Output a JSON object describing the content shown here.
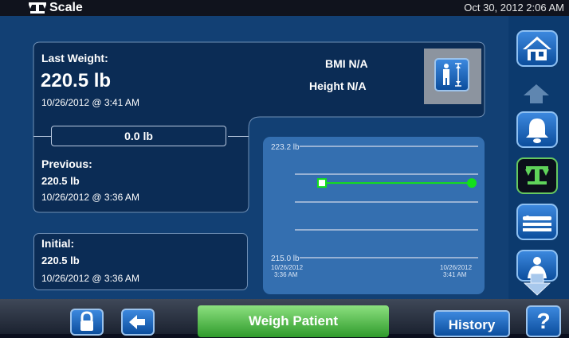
{
  "header": {
    "title": "Scale",
    "datetime": "Oct 30, 2012 2:06 AM"
  },
  "last_weight": {
    "label": "Last Weight:",
    "value": "220.5 lb",
    "timestamp": "10/26/2012 @ 3:41 AM"
  },
  "bmi": "BMI N/A",
  "height": "Height N/A",
  "difference": "0.0 lb",
  "previous": {
    "label": "Previous:",
    "value": "220.5 lb",
    "timestamp": "10/26/2012 @ 3:36 AM"
  },
  "initial": {
    "label": "Initial:",
    "value": "220.5 lb",
    "timestamp": "10/26/2012 @ 3:36 AM"
  },
  "chart_data": {
    "type": "line",
    "ylim": [
      215.0,
      223.2
    ],
    "y_tick_labels": [
      "223.2 lb",
      "215.0 lb"
    ],
    "x_labels": [
      {
        "date": "10/26/2012",
        "time": "3:36 AM"
      },
      {
        "date": "10/26/2012",
        "time": "3:41 AM"
      }
    ],
    "series": [
      {
        "x": [
          "3:36 AM",
          "3:41 AM"
        ],
        "values": [
          220.5,
          220.5
        ]
      }
    ],
    "grid": true,
    "colors": {
      "line": "#12e01a",
      "grid": "#b9c9e0"
    }
  },
  "bottom": {
    "weigh_label": "Weigh Patient",
    "history_label": "History",
    "help_label": "?"
  },
  "sidebar": {
    "items": [
      "home",
      "alarm-bell",
      "scale",
      "bed",
      "patient-turn"
    ]
  },
  "colors": {
    "accent_green": "#2f9b2c",
    "primary_blue": "#124074",
    "panel": "#0b2c55"
  }
}
